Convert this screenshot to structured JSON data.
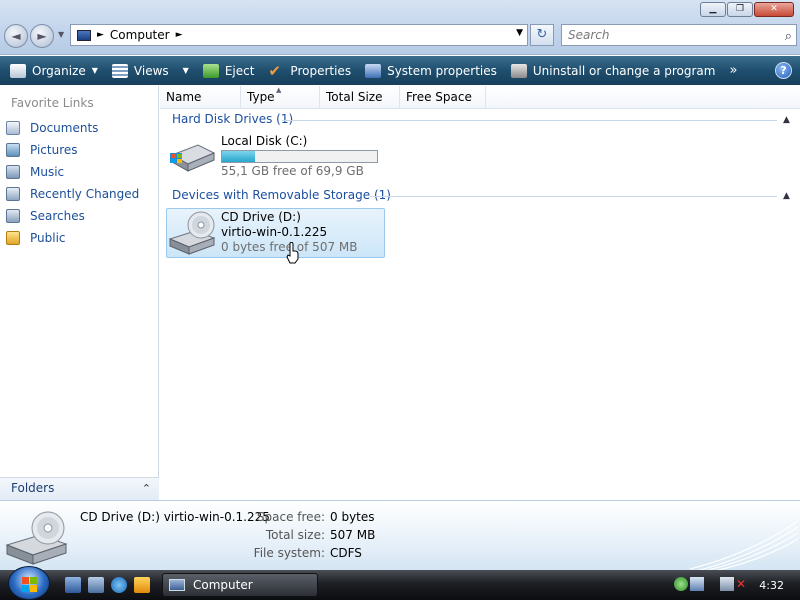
{
  "window": {
    "minimize_glyph": "▁",
    "maximize_glyph": "❐",
    "close_glyph": "✕"
  },
  "address_bar": {
    "back_glyph": "◄",
    "forward_glyph": "►",
    "dropdown_glyph": "▼",
    "location": "Computer",
    "crumb_arrow": "►",
    "refresh_glyph": "↻"
  },
  "search": {
    "placeholder": "Search",
    "icon_glyph": "⌕"
  },
  "toolbar": {
    "organize": "Organize",
    "views": "Views",
    "eject": "Eject",
    "properties": "Properties",
    "system_properties": "System properties",
    "uninstall": "Uninstall or change a program",
    "more": "»",
    "help": "?",
    "dropdown_arrow": "▼"
  },
  "sidebar": {
    "title": "Favorite Links",
    "items": [
      {
        "label": "Documents",
        "icon": "documents-icon"
      },
      {
        "label": "Pictures",
        "icon": "pictures-icon"
      },
      {
        "label": "Music",
        "icon": "music-icon"
      },
      {
        "label": "Recently Changed",
        "icon": "recently-changed-icon"
      },
      {
        "label": "Searches",
        "icon": "searches-icon"
      },
      {
        "label": "Public",
        "icon": "public-folder-icon"
      }
    ],
    "folders_label": "Folders",
    "folders_chevron": "⌃"
  },
  "columns": {
    "name": "Name",
    "type": "Type",
    "total_size": "Total Size",
    "free_space": "Free Space",
    "sort_glyph": "▲"
  },
  "groups": [
    {
      "title": "Hard Disk Drives (1)",
      "chevron": "▲",
      "items": [
        {
          "name": "Local Disk (C:)",
          "free_text": "55,1 GB free of 69,9 GB",
          "used_fraction": 0.21
        }
      ]
    },
    {
      "title": "Devices with Removable Storage (1)",
      "chevron": "▲",
      "items": [
        {
          "name": "CD Drive (D:)",
          "label": "virtio-win-0.1.225",
          "free_text": "0 bytes free of 507 MB"
        }
      ]
    }
  ],
  "details": {
    "title": "CD Drive (D:) virtio-win-0.1.225",
    "space_free_label": "Space free:",
    "space_free": "0 bytes",
    "total_size_label": "Total size:",
    "total_size": "507 MB",
    "file_system_label": "File system:",
    "file_system": "CDFS"
  },
  "taskbar": {
    "task_label": "Computer",
    "clock": "4:32"
  },
  "colors": {
    "cmdbar": "#1f4e6e",
    "link": "#1c4f99",
    "group_title": "#1c4fa0",
    "selection": "#cce6f8",
    "progress": "#27a6cc"
  }
}
